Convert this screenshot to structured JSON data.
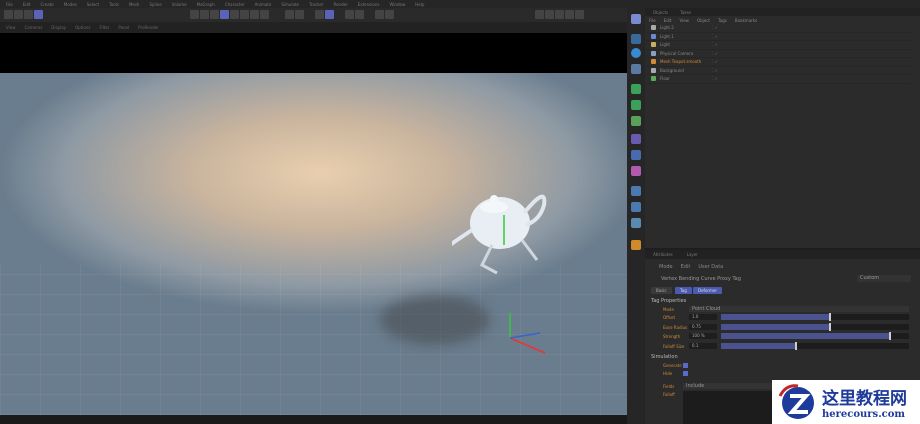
{
  "menubar": [
    "File",
    "Edit",
    "Create",
    "Modes",
    "Select",
    "Tools",
    "Mesh",
    "Spline",
    "Volume",
    "MoGraph",
    "Character",
    "Animate",
    "Simulate",
    "Tracker",
    "Render",
    "Extensions",
    "Window",
    "Help"
  ],
  "viewport_menu": [
    "View",
    "Cameras",
    "Display",
    "Options",
    "Filter",
    "Panel",
    "ProRender"
  ],
  "object_manager": {
    "tabs": [
      "Objects",
      "Takes"
    ],
    "menu": [
      "File",
      "Edit",
      "View",
      "Object",
      "Tags",
      "Bookmarks"
    ],
    "objects": [
      {
        "name": "Light.2",
        "color": "#aaaaaa"
      },
      {
        "name": "Light.1",
        "color": "#6a8ad0"
      },
      {
        "name": "Light",
        "color": "#c8b060"
      },
      {
        "name": "Physical Camera",
        "color": "#8aa0c0"
      },
      {
        "name": "Mesh Teapot.smooth",
        "color": "#d08a3a"
      },
      {
        "name": "Background",
        "color": "#aaaaaa"
      },
      {
        "name": "Floor",
        "color": "#5aaa5a"
      }
    ]
  },
  "attribute_manager": {
    "tabs": [
      "Attributes",
      "Layer"
    ],
    "menu": [
      "Mode",
      "Edit",
      "User Data"
    ],
    "title": "Vertex Bending Curve Proxy Tag",
    "dropdown": "Custom",
    "buttons": [
      "Basic",
      "Tag",
      "Deformer"
    ],
    "section1": "Tag Properties",
    "mode_label": "Mode",
    "mode_value": "Point Cloud",
    "params": [
      {
        "label": "Offset",
        "value": "1.0",
        "fraction": 0.58
      },
      {
        "label": "Ease Radius",
        "value": "0.75",
        "fraction": 0.58
      },
      {
        "label": "Strength",
        "value": "100 %",
        "fraction": 0.9
      },
      {
        "label": "Falloff Size",
        "value": "0.1",
        "fraction": 0.4
      }
    ],
    "section2": "Simulation",
    "checks": [
      {
        "label": "Generate",
        "checked": true
      },
      {
        "label": "Hide",
        "checked": true
      }
    ],
    "field_label": "Fields",
    "field_value": "Include",
    "list_label": "Falloff"
  },
  "watermark": {
    "title": "这里教程网",
    "url": "herecours.com"
  }
}
